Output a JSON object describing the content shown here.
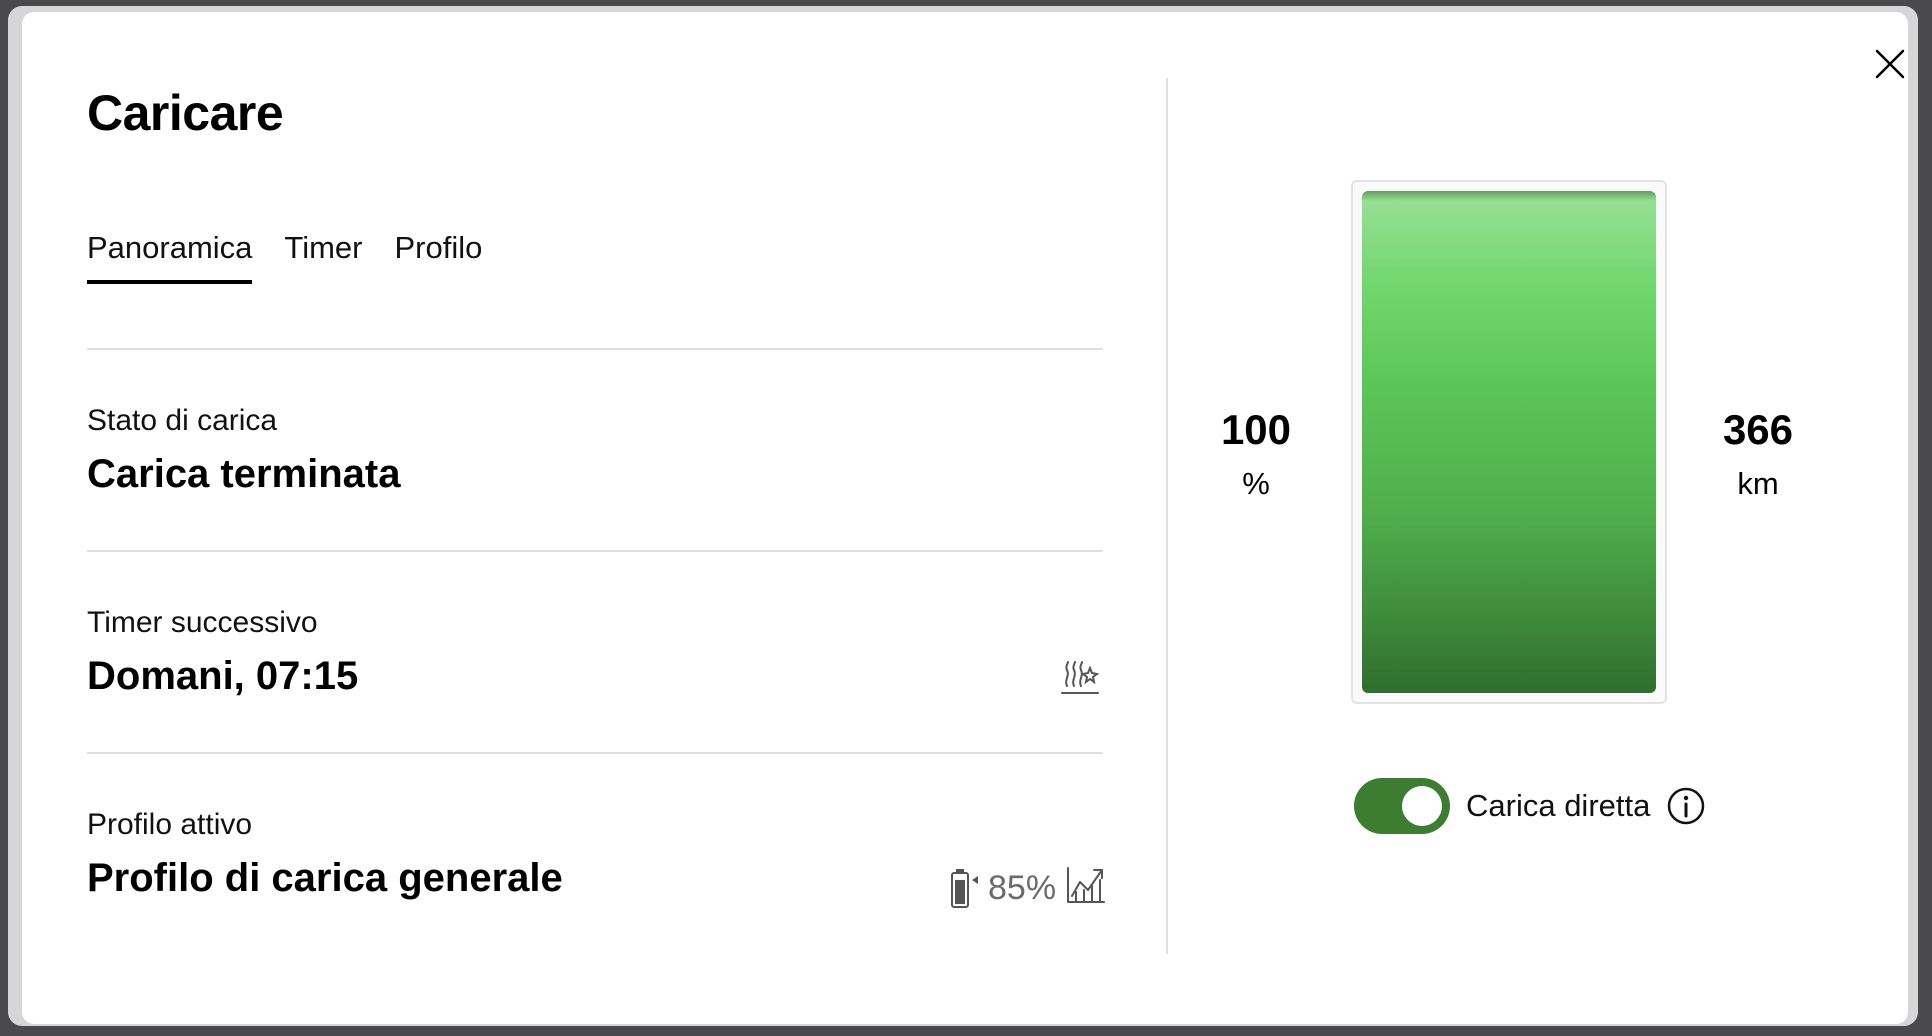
{
  "dialog": {
    "title": "Caricare",
    "close_icon": "close-icon"
  },
  "tabs": [
    {
      "label": "Panoramica",
      "active": true
    },
    {
      "label": "Timer",
      "active": false
    },
    {
      "label": "Profilo",
      "active": false
    }
  ],
  "status": {
    "label": "Stato di carica",
    "value": "Carica terminata"
  },
  "timer": {
    "label": "Timer successivo",
    "value": "Domani, 07:15",
    "icon": "climate-timer-icon"
  },
  "profile": {
    "label": "Profilo attivo",
    "value": "Profilo di carica generale",
    "battery_icon": "battery-target-icon",
    "target": "85%",
    "chart_icon": "charging-chart-icon"
  },
  "battery": {
    "charge_value": "100",
    "charge_unit": "%",
    "range_value": "366",
    "range_unit": "km",
    "fill_level": 1.0,
    "color": "#5bc458"
  },
  "direct_charge": {
    "label": "Carica diretta",
    "enabled": true,
    "toggle_color": "#3c7d31",
    "info_icon": "info-icon"
  }
}
